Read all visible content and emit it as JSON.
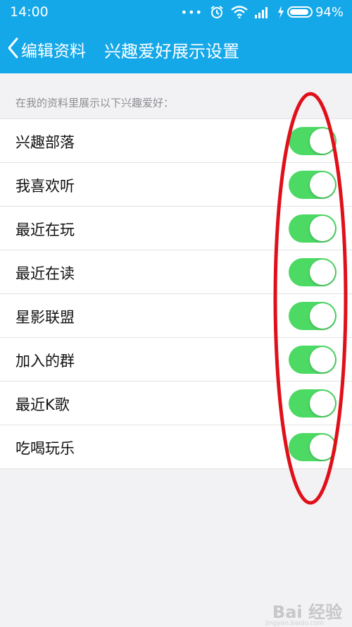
{
  "status_bar": {
    "time": "14:00",
    "dots": "•••",
    "battery_percent": "94%",
    "battery_level": 0.94,
    "icons": [
      "alarm-icon",
      "wifi-icon",
      "signal-icon",
      "charging-icon",
      "battery-icon"
    ]
  },
  "nav": {
    "back_label": "编辑资料",
    "title": "兴趣爱好展示设置"
  },
  "section_caption": "在我的资料里展示以下兴趣爱好：",
  "items": [
    {
      "label": "兴趣部落",
      "on": true
    },
    {
      "label": "我喜欢听",
      "on": true
    },
    {
      "label": "最近在玩",
      "on": true
    },
    {
      "label": "最近在读",
      "on": true
    },
    {
      "label": "星影联盟",
      "on": true
    },
    {
      "label": "加入的群",
      "on": true
    },
    {
      "label": "最近K歌",
      "on": true
    },
    {
      "label": "吃喝玩乐",
      "on": true
    }
  ],
  "colors": {
    "header": "#14a8e9",
    "toggle_on": "#4cd964",
    "annotation": "#e0101a",
    "background": "#f2f2f4"
  },
  "watermark": {
    "text": "Bai 经验",
    "sub": "jingyan.baidu.com"
  }
}
